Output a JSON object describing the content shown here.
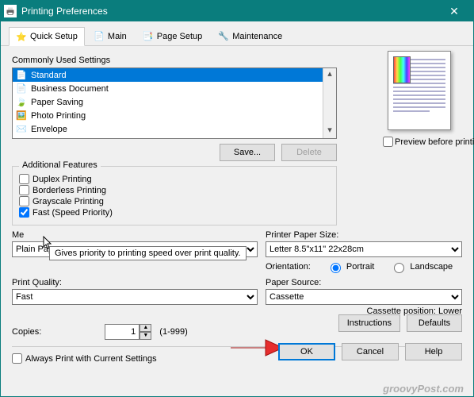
{
  "window": {
    "title": "Printing Preferences"
  },
  "tabs": [
    "Quick Setup",
    "Main",
    "Page Setup",
    "Maintenance"
  ],
  "commonly_used": {
    "label": "Commonly Used Settings",
    "items": [
      "Standard",
      "Business Document",
      "Paper Saving",
      "Photo Printing",
      "Envelope"
    ],
    "selected_index": 0
  },
  "buttons": {
    "save": "Save...",
    "delete": "Delete",
    "instructions": "Instructions",
    "defaults": "Defaults",
    "ok": "OK",
    "cancel": "Cancel",
    "help": "Help"
  },
  "preview_label": "Preview before printing",
  "features": {
    "label": "Additional Features",
    "duplex": "Duplex Printing",
    "borderless": "Borderless Printing",
    "grayscale": "Grayscale Printing",
    "fast": "Fast (Speed Priority)",
    "fast_checked": true,
    "tooltip": "Gives priority to printing speed over print quality."
  },
  "media": {
    "label_prefix": "Me",
    "value": "Plain Paper"
  },
  "paper_size": {
    "label": "Printer Paper Size:",
    "value": "Letter 8.5\"x11\" 22x28cm"
  },
  "orientation": {
    "label": "Orientation:",
    "portrait": "Portrait",
    "landscape": "Landscape",
    "selected": "portrait"
  },
  "quality": {
    "label": "Print Quality:",
    "value": "Fast"
  },
  "source": {
    "label": "Paper Source:",
    "value": "Cassette"
  },
  "cassette_position": "Cassette position: Lower",
  "copies": {
    "label": "Copies:",
    "value": "1",
    "range": "(1-999)"
  },
  "always_print": "Always Print with Current Settings",
  "watermark": "groovyPost.com"
}
